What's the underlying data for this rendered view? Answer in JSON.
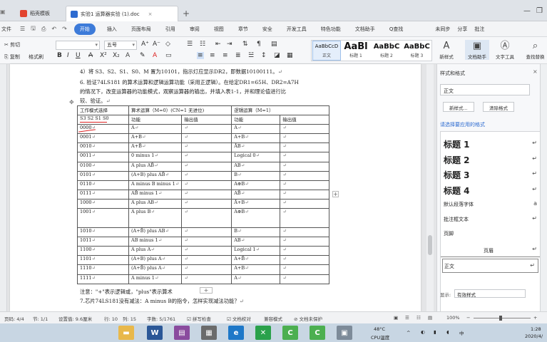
{
  "tabs": [
    {
      "label": "稻壳模板",
      "active": false
    },
    {
      "label": "实验1 运算器实验 (1).doc",
      "active": true
    }
  ],
  "menu": {
    "quick": [
      "文件",
      "☰",
      "🖫",
      "⎙",
      "↶",
      "↷"
    ],
    "items": [
      "开始",
      "插入",
      "页面布局",
      "引用",
      "审阅",
      "视图",
      "章节",
      "安全",
      "开发工具",
      "特色功能",
      "文档助手",
      "Q查找"
    ],
    "right": [
      "未同步",
      "分享",
      "批注"
    ]
  },
  "ribbon": {
    "cut": "剪切",
    "copy": "复制",
    "format_painter": "格式刷",
    "font_name": "",
    "font_size": "五号",
    "styles": [
      {
        "preview": "AaBbCcD",
        "label": "正文",
        "active": true
      },
      {
        "preview": "AaBl",
        "label": "标题 1",
        "active": false
      },
      {
        "preview": "AaBbC",
        "label": "标题 2",
        "active": false
      },
      {
        "preview": "AaBbC",
        "label": "标题 3",
        "active": false
      }
    ],
    "new_style": "新样式",
    "doc_helper": "文档助手",
    "text_tools": "文字工具",
    "find_replace": "查找替换"
  },
  "document": {
    "lines": [
      "4）将 S3、S2、S1、S0、M 置为10101，指示灯应显示DR2，即数据10100111。",
      "6. 验证74LS181 的算术运算和逻辑运算功能（采用正逻辑）。在给定DR1=65H、DR2=A7H",
      "的情况下，改变运算器的功能模式，观察运算器的输出，并填入表1-1，并和理论值进行比",
      "较、验证。"
    ],
    "note": "注意：\"+\"表示逻辑或，\"plus\"表示算术",
    "question": "7.芯片74LS181没有减法：A minus B的指令，怎样实现减法功能？",
    "table": {
      "header": [
        "工作模式选择",
        "算术运算（M=0）(CN=1 无进位)",
        "",
        "逻辑运算（M=1）",
        ""
      ],
      "subheader": [
        "S3 S2 S1 S0",
        "功能",
        "输出值",
        "功能",
        "输出值"
      ],
      "rows": [
        {
          "mode": "0000",
          "arith": "A",
          "logic": "A",
          "logic_ovl": true,
          "tall": false
        },
        {
          "mode": "0001",
          "arith": "A+B",
          "logic": "A+B",
          "logic_ovl": true,
          "tall": false
        },
        {
          "mode": "0010",
          "arith": "A+B̄",
          "logic": "ĀB",
          "logic_ovl": false,
          "tall": false
        },
        {
          "mode": "0011",
          "arith": "0 minus 1",
          "logic": "Logical 0",
          "logic_ovl": false,
          "tall": false
        },
        {
          "mode": "0100",
          "arith": "A plus AB̄",
          "logic": "AB",
          "logic_ovl": true,
          "tall": false
        },
        {
          "mode": "0101",
          "arith": "(A+B) plus AB̄",
          "logic": "B",
          "logic_ovl": true,
          "tall": false
        },
        {
          "mode": "0110",
          "arith": "A minus B minus 1",
          "logic": "A⊕B",
          "logic_ovl": false,
          "tall": false
        },
        {
          "mode": "0111",
          "arith": "AB̄ minus 1",
          "logic": "AB̄",
          "logic_ovl": false,
          "tall": false
        },
        {
          "mode": "1000",
          "arith": "A plus AB",
          "logic": "Ā+B",
          "logic_ovl": false,
          "tall": false
        },
        {
          "mode": "1001",
          "arith": "A plus B",
          "logic": "A⊕B",
          "logic_ovl": true,
          "tall": true
        },
        {
          "mode": "1010",
          "arith": "(A+B̄) plus AB",
          "logic": "B",
          "logic_ovl": false,
          "tall": false
        },
        {
          "mode": "1011",
          "arith": "AB minus 1",
          "logic": "AB",
          "logic_ovl": false,
          "tall": false
        },
        {
          "mode": "1100",
          "arith": "A plus A",
          "logic": "Logical 1",
          "logic_ovl": false,
          "tall": false
        },
        {
          "mode": "1101",
          "arith": "(A+B) plus A",
          "logic": "A+B̄",
          "logic_ovl": false,
          "tall": false
        },
        {
          "mode": "1110",
          "arith": "(A+B̄) plus A",
          "logic": "A+B",
          "logic_ovl": false,
          "tall": false
        },
        {
          "mode": "1111",
          "arith": "A minus 1",
          "logic": "A",
          "logic_ovl": false,
          "tall": false
        }
      ]
    }
  },
  "pane": {
    "title": "样式和格式",
    "current_style": "正文",
    "new_style_btn": "新样式...",
    "clear_format_btn": "清除格式",
    "apply_label": "请选择要应用的格式",
    "styles": [
      {
        "label": "标题 1",
        "heading": true
      },
      {
        "label": "标题 2",
        "heading": true
      },
      {
        "label": "标题 3",
        "heading": true
      },
      {
        "label": "标题 4",
        "heading": true
      },
      {
        "label": "默认段落字体",
        "heading": false
      },
      {
        "label": "批注框文本",
        "heading": false
      },
      {
        "label": "页脚",
        "heading": false
      },
      {
        "label": "页眉",
        "heading": false
      },
      {
        "label": "正文",
        "heading": false
      }
    ],
    "show_label": "显示:",
    "show_value": "有效样式"
  },
  "status": {
    "page": "页码: 4/4",
    "section": "节: 1/1",
    "setting": "设置值: 9.6厘米",
    "row": "行: 10",
    "col": "列: 15",
    "words": "字数: 5/1761",
    "spell": "拼写检查",
    "doc_check": "文档校对",
    "compat": "兼容模式",
    "unprotected": "文档未保护",
    "zoom": "100%"
  },
  "taskbar": {
    "temp": "48°C",
    "cpu": "CPU温度",
    "time": "1:28",
    "date": "2020/4/"
  }
}
